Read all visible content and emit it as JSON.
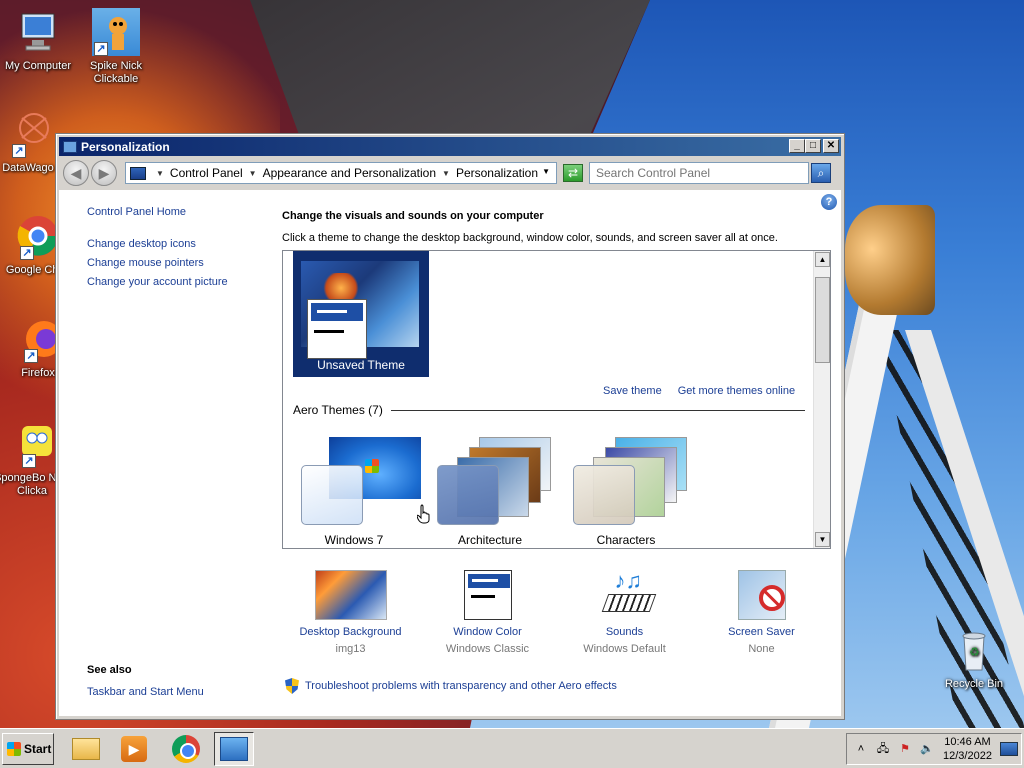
{
  "desktop": {
    "icons": [
      {
        "label": "My Computer",
        "icon": "computer-icon"
      },
      {
        "label": "Spike Nick Clickable",
        "icon": "spike-icon"
      },
      {
        "label": "DataWago",
        "icon": "datawago-icon"
      },
      {
        "label": "Google Chr",
        "icon": "chrome-icon"
      },
      {
        "label": "Firefox",
        "icon": "firefox-icon"
      },
      {
        "label": "SpongeBo Nick Clicka",
        "icon": "spongebob-icon"
      },
      {
        "label": "Recycle Bin",
        "icon": "recycle-bin-icon"
      }
    ]
  },
  "window": {
    "title": "Personalization",
    "controls": {
      "minimize": "_",
      "maximize": "□",
      "close": "✕"
    },
    "address": {
      "crumbs": [
        "Control Panel",
        "Appearance and Personalization",
        "Personalization"
      ],
      "search_placeholder": "Search Control Panel"
    }
  },
  "sidebar": {
    "home": "Control Panel Home",
    "links": [
      "Change desktop icons",
      "Change mouse pointers",
      "Change your account picture"
    ],
    "see_also_heading": "See also",
    "see_also_links": [
      "Taskbar and Start Menu"
    ]
  },
  "main": {
    "heading": "Change the visuals and sounds on your computer",
    "description": "Click a theme to change the desktop background, window color, sounds, and screen saver all at once.",
    "unsaved_theme": "Unsaved Theme",
    "save_theme": "Save theme",
    "get_more_themes": "Get more themes online",
    "group_heading": "Aero Themes (7)",
    "themes": [
      "Windows 7",
      "Architecture",
      "Characters"
    ]
  },
  "bottom": {
    "items": [
      {
        "name": "Desktop Background",
        "sub": "img13"
      },
      {
        "name": "Window Color",
        "sub": "Windows Classic"
      },
      {
        "name": "Sounds",
        "sub": "Windows Default"
      },
      {
        "name": "Screen Saver",
        "sub": "None"
      }
    ],
    "troubleshoot": "Troubleshoot problems with transparency and other Aero effects"
  },
  "taskbar": {
    "start_label": "Start",
    "time": "10:46 AM",
    "date": "12/3/2022"
  }
}
